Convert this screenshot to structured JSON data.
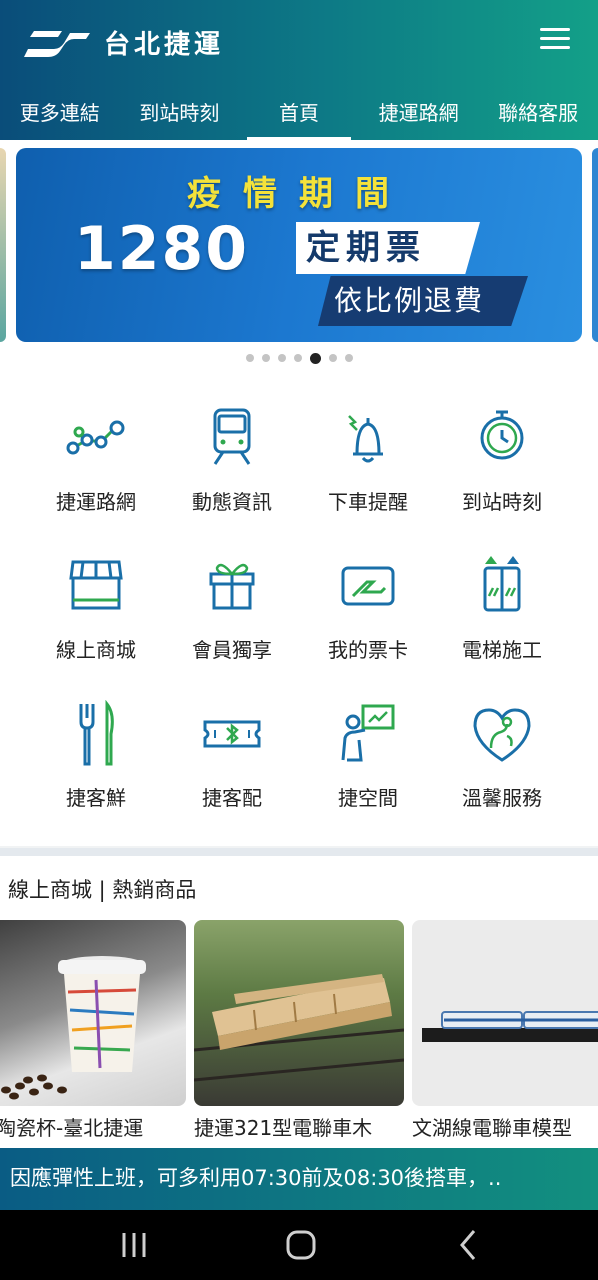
{
  "header": {
    "app_title": "台北捷運",
    "menu_icon": "hamburger-menu-icon"
  },
  "tabs": [
    {
      "label": "更多連結",
      "active": false
    },
    {
      "label": "到站時刻",
      "active": false
    },
    {
      "label": "首頁",
      "active": true
    },
    {
      "label": "捷運路網",
      "active": false
    },
    {
      "label": "聯絡客服",
      "active": false
    }
  ],
  "banner": {
    "title": "疫情期間",
    "number": "1280",
    "tag": "定期票",
    "subtitle": "依比例退費",
    "page_count": 7,
    "active_index": 4
  },
  "shortcuts": [
    {
      "label": "捷運路網",
      "icon": "route-map-icon"
    },
    {
      "label": "動態資訊",
      "icon": "train-icon"
    },
    {
      "label": "下車提醒",
      "icon": "bell-icon"
    },
    {
      "label": "到站時刻",
      "icon": "stopwatch-icon"
    },
    {
      "label": "線上商城",
      "icon": "shop-icon"
    },
    {
      "label": "會員獨享",
      "icon": "gift-icon"
    },
    {
      "label": "我的票卡",
      "icon": "ticket-card-icon"
    },
    {
      "label": "電梯施工",
      "icon": "elevator-icon"
    },
    {
      "label": "捷客鮮",
      "icon": "fork-knife-icon"
    },
    {
      "label": "捷客配",
      "icon": "bluetooth-ticket-icon"
    },
    {
      "label": "捷空間",
      "icon": "presentation-icon"
    },
    {
      "label": "溫馨服務",
      "icon": "heart-care-icon"
    }
  ],
  "shop": {
    "title": "線上商城 | 熱銷商品",
    "products": [
      {
        "name": "層陶瓷杯-臺北捷運"
      },
      {
        "name": "捷運321型電聯車木"
      },
      {
        "name": "文湖線電聯車模型"
      }
    ]
  },
  "marquee": {
    "text": "因應彈性上班，可多利用07:30前及08:30後搭車，.."
  },
  "colors": {
    "brand_teal": "#0d7a86",
    "brand_blue": "#0a4d7a",
    "icon_blue": "#1a6fa8",
    "icon_green": "#2fa84f"
  },
  "navbar": [
    "recent-apps-icon",
    "home-icon",
    "back-icon"
  ]
}
